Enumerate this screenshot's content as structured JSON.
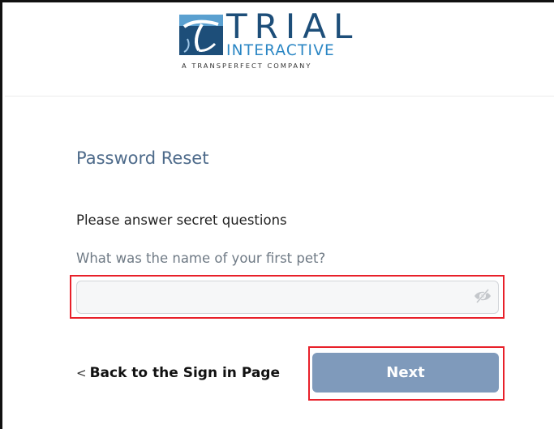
{
  "brand": {
    "name_top": "TRIAL",
    "name_bottom": "INTERACTIVE",
    "tagline": "A TRANSPERFECT COMPANY",
    "logo_icon": "trial-interactive-logo-icon",
    "colors": {
      "primary": "#1d4e79",
      "accent": "#2a86c4"
    }
  },
  "page": {
    "title": "Password Reset",
    "instructions": "Please answer secret questions"
  },
  "form": {
    "question": "What was the name of your first pet?",
    "answer_value": "",
    "answer_placeholder": "",
    "visibility_icon": "eye-slash-icon"
  },
  "actions": {
    "back_chevron": "<",
    "back_label": "Back to the Sign in Page",
    "next_label": "Next",
    "next_color": "#7f9abb",
    "highlight_color": "#e8202a"
  }
}
